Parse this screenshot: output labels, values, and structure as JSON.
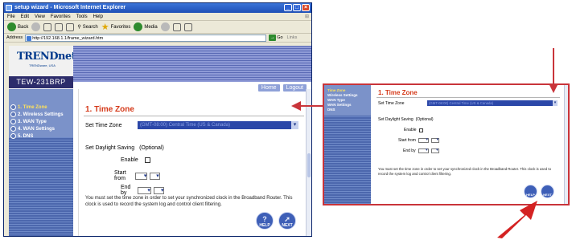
{
  "window": {
    "title": "setup wizard - Microsoft Internet Explorer",
    "menu": [
      "File",
      "Edit",
      "View",
      "Favorites",
      "Tools",
      "Help"
    ],
    "toolbar": {
      "back": "Back",
      "search": "Search",
      "favorites": "Favorites",
      "media": "Media"
    },
    "address_label": "Address",
    "address_value": "http://192.168.1.1/frame_wizard.htm",
    "go_label": "Go",
    "links_label": "Links"
  },
  "brand": {
    "logo": "TRENDnet",
    "tagline": "TRENDware, USA",
    "model": "TEW-231BRP"
  },
  "header_links": [
    "Home",
    "Logout"
  ],
  "sidebar": {
    "items": [
      "1. Time Zone",
      "2. Wireless Settings",
      "3. WAN Type",
      "4. WAN Settings",
      "5. DNS"
    ],
    "active_index": 0
  },
  "form": {
    "title": "1. Time Zone",
    "timezone_label": "Set Time Zone",
    "timezone_value": "(GMT-08:00) Central Time (US & Canada)",
    "dst_label": "Set Daylight Saving",
    "dst_optional": "(Optional)",
    "enable_label": "Enable",
    "start_label": "Start from",
    "end_label": "End by",
    "note": "You must set the time zone in order to set your synchronized clock in the Broadband Router. This clock is used to record the system log and control client filtering.",
    "help_label": "HELP",
    "next_label": "NEXT"
  },
  "callout": {
    "sidebar_items": [
      "Time Zone",
      "Wireless Settings",
      "WAN Type",
      "WAN Settings",
      "DNS"
    ],
    "title": "1. Time Zone",
    "timezone_label": "Set Time Zone",
    "timezone_value": "(GMT-08:00) Central Time (US & Canada)",
    "dst_label": "Set Daylight Saving",
    "dst_optional": "(Optional)",
    "enable_label": "Enable",
    "start_label": "Start from",
    "end_label": "End by",
    "note": "You must set the time zone in order to set your synchronized clock in the Broadband Router. This clock is used to record the system log and control client filtering.",
    "help_label": "HELP",
    "next_label": "NEXT"
  },
  "colors": {
    "accent_red": "#c9343a",
    "title_red": "#d53a1a",
    "nav_blue": "#4c67ad",
    "dropdown_blue": "#2b47a8"
  }
}
